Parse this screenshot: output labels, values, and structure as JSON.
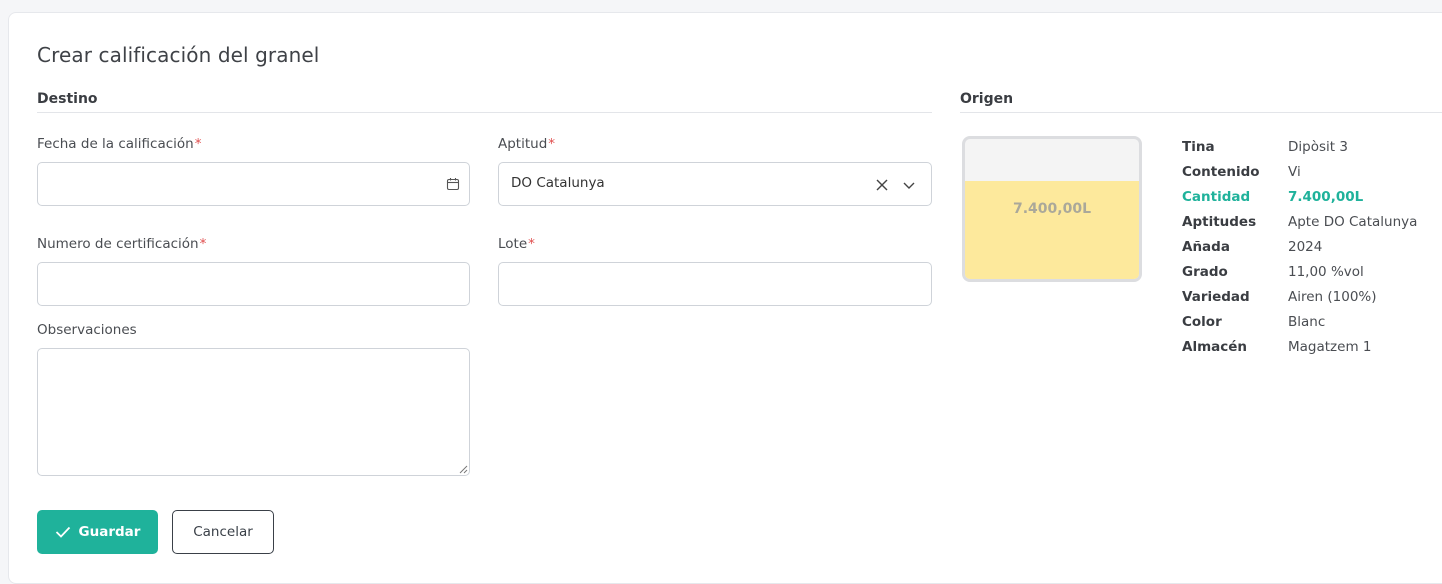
{
  "page": {
    "title": "Crear calificación del granel"
  },
  "destino": {
    "section_title": "Destino",
    "fecha": {
      "label": "Fecha de la calificación",
      "required_mark": "*",
      "value": ""
    },
    "aptitud": {
      "label": "Aptitud",
      "required_mark": "*",
      "value": "DO Catalunya"
    },
    "numero": {
      "label": "Numero de certificación",
      "required_mark": "*",
      "value": ""
    },
    "lote": {
      "label": "Lote",
      "required_mark": "*",
      "value": ""
    },
    "observaciones": {
      "label": "Observaciones",
      "value": ""
    }
  },
  "actions": {
    "save_label": "Guardar",
    "cancel_label": "Cancelar"
  },
  "origen": {
    "section_title": "Origen",
    "tank": {
      "level_label": "7.400,00L",
      "fill_fraction": 0.7
    },
    "details": [
      {
        "key": "Tina",
        "value": "Dipòsit 3"
      },
      {
        "key": "Contenido",
        "value": "Vi"
      },
      {
        "key": "Cantidad",
        "value": "7.400,00L"
      },
      {
        "key": "Aptitudes",
        "value": "Apte DO Catalunya"
      },
      {
        "key": "Añada",
        "value": "2024"
      },
      {
        "key": "Grado",
        "value": "11,00 %vol"
      },
      {
        "key": "Variedad",
        "value": "Airen (100%)"
      },
      {
        "key": "Color",
        "value": "Blanc"
      },
      {
        "key": "Almacén",
        "value": "Magatzem 1"
      }
    ]
  },
  "colors": {
    "accent": "#1fb29b",
    "required": "#e04e4e",
    "tank_fill": "#fde99c"
  }
}
